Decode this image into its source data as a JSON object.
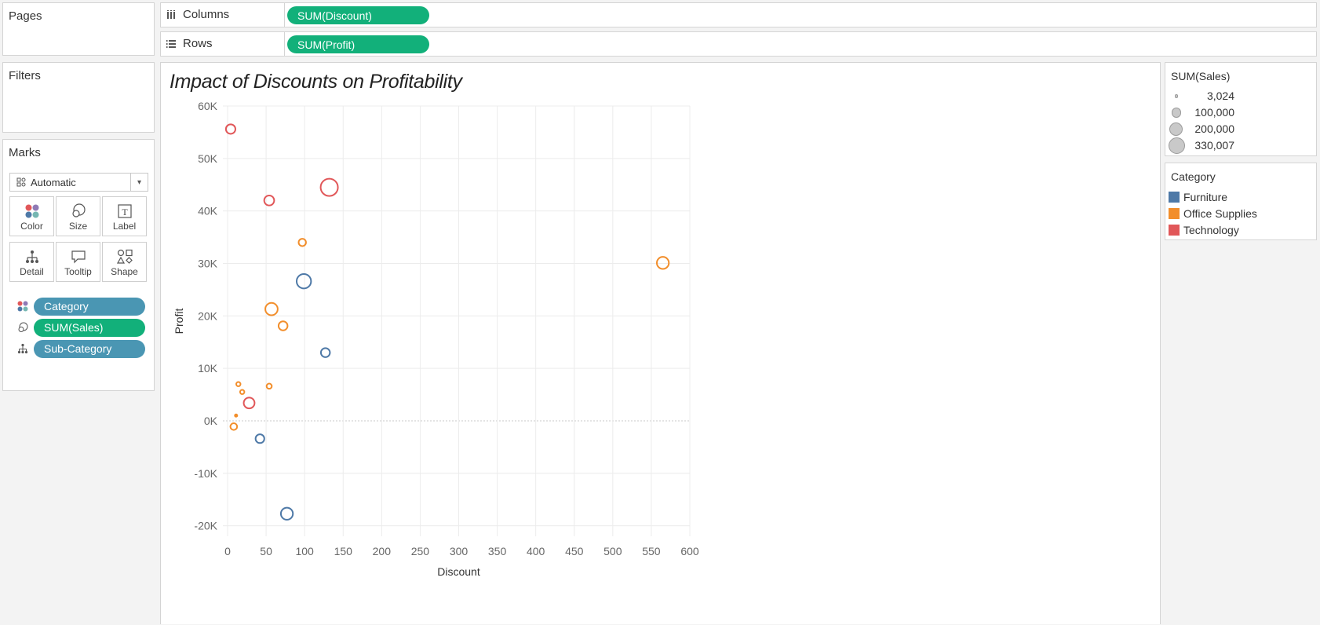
{
  "shelves": {
    "pages_title": "Pages",
    "filters_title": "Filters",
    "columns_label": "Columns",
    "columns_pill": "SUM(Discount)",
    "rows_label": "Rows",
    "rows_pill": "SUM(Profit)"
  },
  "marks": {
    "title": "Marks",
    "type": "Automatic",
    "buttons": [
      "Color",
      "Size",
      "Label",
      "Detail",
      "Tooltip",
      "Shape"
    ],
    "pills": [
      {
        "icon": "color-icon",
        "label": "Category"
      },
      {
        "icon": "size-icon",
        "label": "SUM(Sales)"
      },
      {
        "icon": "detail-icon",
        "label": "Sub-Category"
      }
    ]
  },
  "legends": {
    "size_title": "SUM(Sales)",
    "size_items": [
      "3,024",
      "100,000",
      "200,000",
      "330,007"
    ],
    "size_values": [
      3024,
      100000,
      200000,
      330007
    ],
    "category_title": "Category",
    "categories": [
      {
        "label": "Furniture",
        "color": "#4e79a7"
      },
      {
        "label": "Office Supplies",
        "color": "#f28e2b"
      },
      {
        "label": "Technology",
        "color": "#e15759"
      }
    ]
  },
  "chart_data": {
    "type": "scatter",
    "title": "Impact of Discounts on Profitability",
    "xlabel": "Discount",
    "ylabel": "Profit",
    "xlim": [
      0,
      600
    ],
    "ylim": [
      -22000,
      60000
    ],
    "x_ticks": [
      0,
      50,
      100,
      150,
      200,
      250,
      300,
      350,
      400,
      450,
      500,
      550,
      600
    ],
    "x_tick_labels": [
      "0",
      "50",
      "100",
      "150",
      "200",
      "250",
      "300",
      "350",
      "400",
      "450",
      "500",
      "550",
      "600"
    ],
    "y_ticks": [
      60000,
      50000,
      40000,
      30000,
      20000,
      10000,
      0,
      -10000,
      -20000
    ],
    "y_tick_labels": [
      "60K",
      "50K",
      "40K",
      "30K",
      "20K",
      "10K",
      "0K",
      "-10K",
      "-20K"
    ],
    "grid": true,
    "series": [
      {
        "name": "Furniture",
        "color": "#4e79a7",
        "points": [
          {
            "x": 99,
            "y": 26600,
            "sales": 230000
          },
          {
            "x": 127,
            "y": 13000,
            "sales": 90000
          },
          {
            "x": 42,
            "y": -3400,
            "sales": 85000
          },
          {
            "x": 77,
            "y": -17700,
            "sales": 160000
          }
        ]
      },
      {
        "name": "Office Supplies",
        "color": "#f28e2b",
        "points": [
          {
            "x": 565,
            "y": 30100,
            "sales": 160000
          },
          {
            "x": 97,
            "y": 34000,
            "sales": 60000
          },
          {
            "x": 57,
            "y": 21300,
            "sales": 170000
          },
          {
            "x": 72,
            "y": 18100,
            "sales": 90000
          },
          {
            "x": 54,
            "y": 6600,
            "sales": 30000
          },
          {
            "x": 14,
            "y": 7000,
            "sales": 20000
          },
          {
            "x": 19,
            "y": 5500,
            "sales": 20000
          },
          {
            "x": 11,
            "y": 1000,
            "sales": 5000
          },
          {
            "x": 8,
            "y": -1100,
            "sales": 50000
          }
        ]
      },
      {
        "name": "Technology",
        "color": "#e15759",
        "points": [
          {
            "x": 4,
            "y": 55600,
            "sales": 100000
          },
          {
            "x": 54,
            "y": 42000,
            "sales": 110000
          },
          {
            "x": 132,
            "y": 44500,
            "sales": 330007
          },
          {
            "x": 28,
            "y": 3400,
            "sales": 130000
          }
        ]
      }
    ]
  }
}
